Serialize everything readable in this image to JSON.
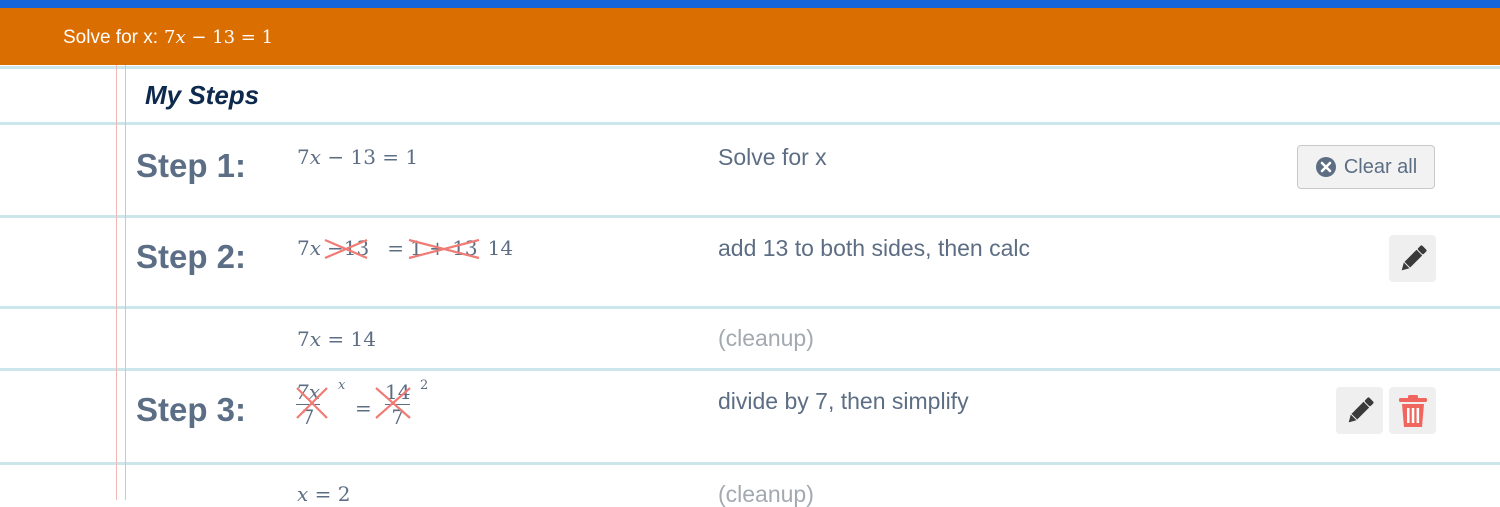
{
  "header": {
    "prefix": "Solve for x:",
    "equation": {
      "coef": "7",
      "var": "x",
      "rest": " − 13 = 1"
    }
  },
  "title": "My Steps",
  "buttons": {
    "clear_all_label": "Clear all"
  },
  "icons": {
    "clear": "circle-x-icon",
    "edit": "pencil-icon",
    "delete": "trash-icon"
  },
  "colors": {
    "header": "#db6e00",
    "topbar": "#1565d8",
    "strike": "#f07b74",
    "delete": "#f0665f"
  },
  "steps": [
    {
      "label": "Step 1:",
      "math": {
        "coef": "7",
        "var": "x",
        "rest": " − 13 = 1"
      },
      "reason": "Solve for x"
    },
    {
      "label": "Step 2:",
      "math": {
        "coef": "7",
        "var": "x",
        "minus": "−",
        "struck1": "13",
        "eq": "=",
        "struck2": "1 + 13",
        "result": "14"
      },
      "reason": "add 13 to both sides, then calc"
    },
    {
      "label": "",
      "math": {
        "coef": "7",
        "var": "x",
        "rest": " = 14"
      },
      "reason": "(cleanup)"
    },
    {
      "label": "Step 3:",
      "math": {
        "num1": "7x",
        "den1": "7",
        "sup1": "x",
        "eq": "=",
        "num2": "14",
        "den2": "7",
        "sup2": "2"
      },
      "reason": "divide by 7, then simplify"
    },
    {
      "label": "",
      "math": {
        "var": "x",
        "rest": " = 2"
      },
      "reason": "(cleanup)"
    }
  ]
}
